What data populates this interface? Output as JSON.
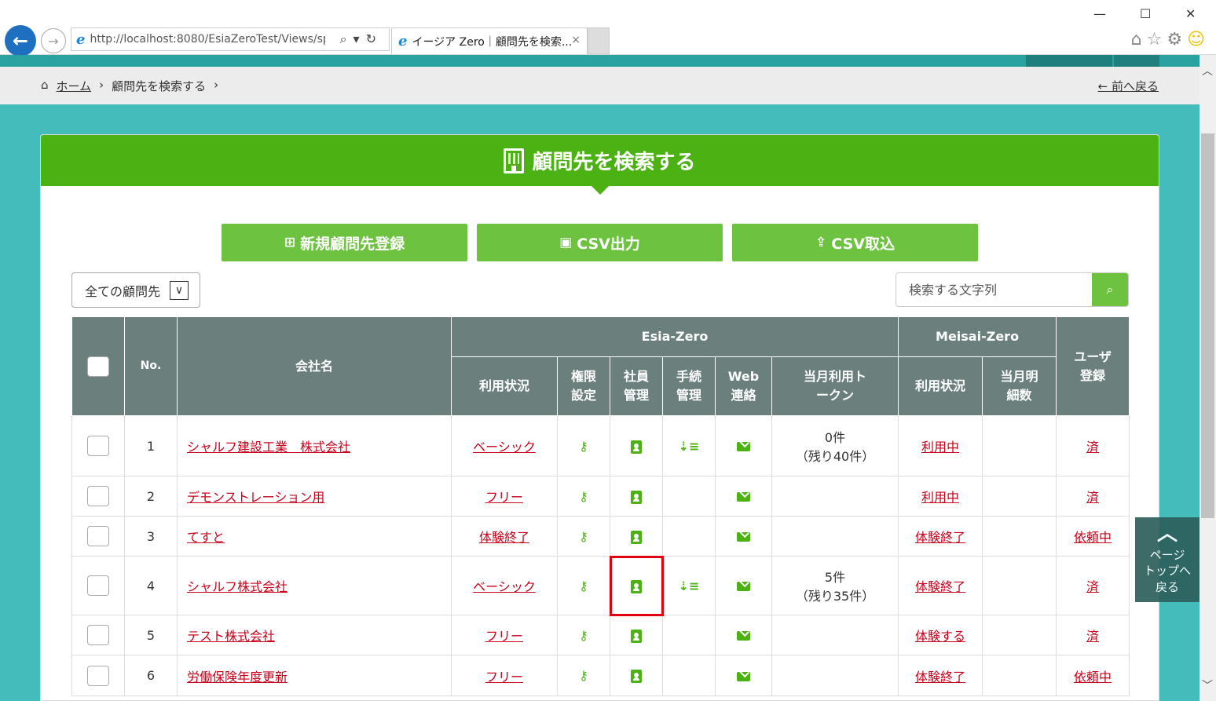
{
  "browser": {
    "url": "http://localhost:8080/EsiaZeroTest/Views/sp",
    "tab_title": "イージア Zero｜顧問先を検索...",
    "close": "×"
  },
  "breadcrumb": {
    "home": "ホーム",
    "current": "顧問先を検索する",
    "back": "前へ戻る"
  },
  "panel": {
    "title": "顧問先を検索する"
  },
  "buttons": {
    "new_client": "新規顧問先登録",
    "csv_export": "CSV出力",
    "csv_import": "CSV取込"
  },
  "filter": {
    "selected": "全ての顧問先"
  },
  "search": {
    "placeholder": "検索する文字列"
  },
  "table": {
    "headers": {
      "no": "No.",
      "company": "会社名",
      "esia_group": "Esia-Zero",
      "meisai_group": "Meisai-Zero",
      "user_reg": "ユーザ登録",
      "usage": "利用状況",
      "permission": "権限設定",
      "employee": "社員管理",
      "procedure": "手続管理",
      "web": "Web連絡",
      "token": "当月利用トークン",
      "meisai_usage": "利用状況",
      "meisai_count": "当月明細数"
    },
    "rows": [
      {
        "no": "1",
        "company": "シャルフ建設工業　株式会社",
        "usage": "ベーシック",
        "token_line1": "0件",
        "token_line2": "（残り40件）",
        "meisai_usage": "利用中",
        "user_reg": "済"
      },
      {
        "no": "2",
        "company": "デモンストレーション用",
        "usage": "フリー",
        "token_line1": "",
        "token_line2": "",
        "meisai_usage": "利用中",
        "user_reg": "済"
      },
      {
        "no": "3",
        "company": "てすと",
        "usage": "体験終了",
        "token_line1": "",
        "token_line2": "",
        "meisai_usage": "体験終了",
        "user_reg": "依頼中"
      },
      {
        "no": "4",
        "company": "シャルフ株式会社",
        "usage": "ベーシック",
        "token_line1": "5件",
        "token_line2": "（残り35件）",
        "meisai_usage": "体験終了",
        "user_reg": "済"
      },
      {
        "no": "5",
        "company": "テスト株式会社",
        "usage": "フリー",
        "token_line1": "",
        "token_line2": "",
        "meisai_usage": "体験する",
        "user_reg": "済"
      },
      {
        "no": "6",
        "company": "労働保険年度更新",
        "usage": "フリー",
        "token_line1": "",
        "token_line2": "",
        "meisai_usage": "体験終了",
        "user_reg": "依頼中"
      }
    ]
  },
  "pagetop": {
    "label1": "ページ",
    "label2": "トップへ",
    "label3": "戻る"
  },
  "colors": {
    "header_green": "#4cb213",
    "button_green": "#6dc23f",
    "teal_bg": "#45bcbc",
    "table_header": "#6b807c",
    "link_red": "#c8001a",
    "highlight": "#e0000f"
  }
}
